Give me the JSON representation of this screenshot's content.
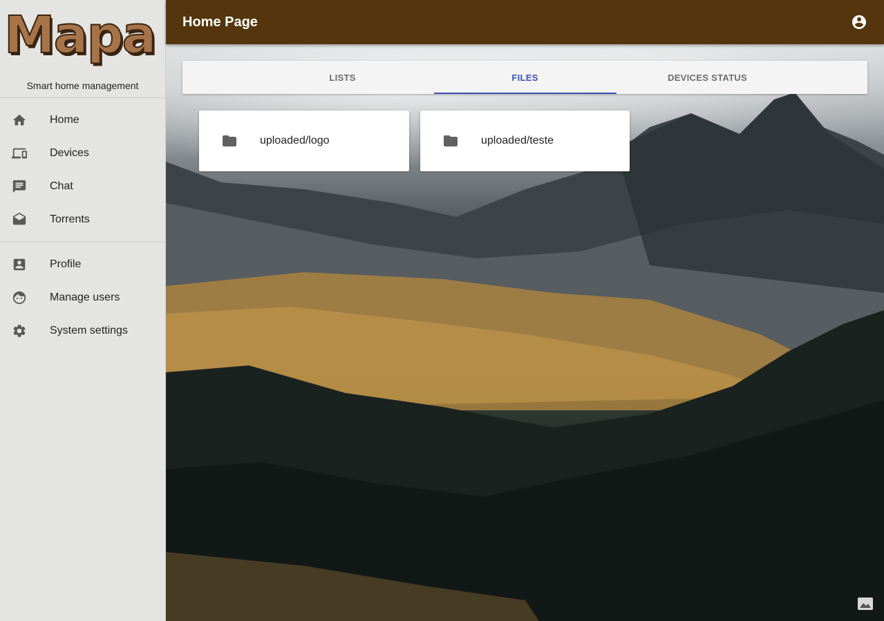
{
  "sidebar": {
    "logo": "Mapa",
    "subtitle": "Smart home management",
    "items": [
      {
        "label": "Home",
        "icon": "home-icon"
      },
      {
        "label": "Devices",
        "icon": "devices-icon"
      },
      {
        "label": "Chat",
        "icon": "chat-icon"
      },
      {
        "label": "Torrents",
        "icon": "drafts-icon"
      },
      {
        "label": "Profile",
        "icon": "account-box-icon"
      },
      {
        "label": "Manage users",
        "icon": "face-icon"
      },
      {
        "label": "System settings",
        "icon": "gear-icon"
      }
    ]
  },
  "header": {
    "title": "Home Page",
    "account_icon": "account-circle-icon",
    "color": "#54350d"
  },
  "tabs": [
    {
      "label": "LISTS",
      "active": false
    },
    {
      "label": "FILES",
      "active": true
    },
    {
      "label": "DEVICES STATUS",
      "active": false
    }
  ],
  "files": [
    {
      "name": "uploaded/logo",
      "icon": "folder-icon"
    },
    {
      "name": "uploaded/teste",
      "icon": "folder-icon"
    }
  ],
  "colors": {
    "accent": "#3f51b5",
    "sidebar_bg": "#e4e5e3"
  },
  "background_button_icon": "image-icon"
}
